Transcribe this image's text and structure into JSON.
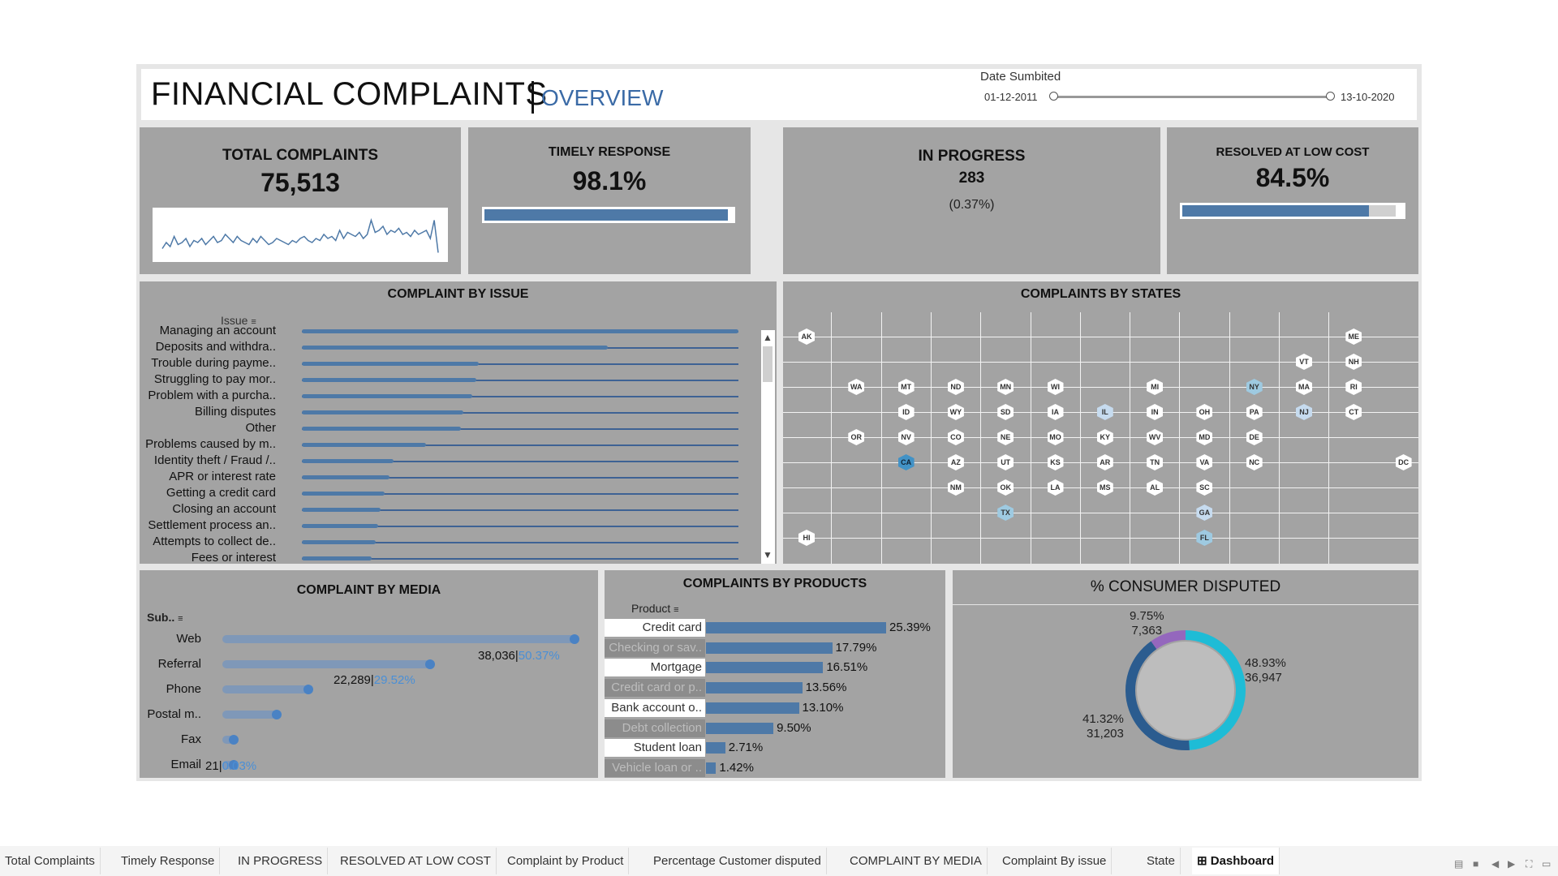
{
  "header": {
    "title": "FINANCIAL COMPLAINTS",
    "subtitle": "OVERVIEW",
    "date_filter": {
      "label": "Date Sumbited",
      "start": "01-12-2011",
      "end": "13-10-2020"
    }
  },
  "kpis": {
    "total": {
      "title": "TOTAL COMPLAINTS",
      "value": "75,513"
    },
    "timely": {
      "title": "TIMELY RESPONSE",
      "value": "98.1%",
      "fraction": 0.981
    },
    "in_progress": {
      "title": "IN PROGRESS",
      "value": "283",
      "pct": "(0.37%)"
    },
    "resolved": {
      "title": "RESOLVED AT LOW COST",
      "value": "84.5%",
      "fraction": 0.845
    }
  },
  "issue_chart": {
    "title": "COMPLAINT BY ISSUE",
    "header": "Issue",
    "items": [
      {
        "label": "Managing an account",
        "value": 1.0
      },
      {
        "label": "Deposits and withdra..",
        "value": 0.7
      },
      {
        "label": "Trouble during payme..",
        "value": 0.405
      },
      {
        "label": "Struggling to pay mor..",
        "value": 0.4
      },
      {
        "label": "Problem with a purcha..",
        "value": 0.39
      },
      {
        "label": "Billing disputes",
        "value": 0.37
      },
      {
        "label": "Other",
        "value": 0.365
      },
      {
        "label": "Problems caused by m..",
        "value": 0.285
      },
      {
        "label": "Identity theft / Fraud /..",
        "value": 0.21
      },
      {
        "label": "APR or interest rate",
        "value": 0.2
      },
      {
        "label": "Getting a credit card",
        "value": 0.19
      },
      {
        "label": "Closing an account",
        "value": 0.18
      },
      {
        "label": "Settlement process an..",
        "value": 0.175
      },
      {
        "label": "Attempts to collect de..",
        "value": 0.17
      },
      {
        "label": "Fees or interest",
        "value": 0.16
      }
    ]
  },
  "states_map": {
    "title": "COMPLAINTS BY STATES",
    "states": [
      {
        "code": "AK",
        "c": 0,
        "r": 0,
        "lvl": 0
      },
      {
        "code": "ME",
        "c": 11,
        "r": 0,
        "lvl": 0
      },
      {
        "code": "VT",
        "c": 10,
        "r": 1,
        "lvl": 0
      },
      {
        "code": "NH",
        "c": 11,
        "r": 1,
        "lvl": 0
      },
      {
        "code": "WA",
        "c": 1,
        "r": 2,
        "lvl": 0
      },
      {
        "code": "MT",
        "c": 2,
        "r": 2,
        "lvl": 0
      },
      {
        "code": "ND",
        "c": 3,
        "r": 2,
        "lvl": 0
      },
      {
        "code": "MN",
        "c": 4,
        "r": 2,
        "lvl": 0
      },
      {
        "code": "WI",
        "c": 5,
        "r": 2,
        "lvl": 0
      },
      {
        "code": "MI",
        "c": 7,
        "r": 2,
        "lvl": 0
      },
      {
        "code": "NY",
        "c": 9,
        "r": 2,
        "lvl": 2
      },
      {
        "code": "MA",
        "c": 10,
        "r": 2,
        "lvl": 0
      },
      {
        "code": "RI",
        "c": 11,
        "r": 2,
        "lvl": 0
      },
      {
        "code": "ID",
        "c": 2,
        "r": 3,
        "lvl": 0
      },
      {
        "code": "WY",
        "c": 3,
        "r": 3,
        "lvl": 0
      },
      {
        "code": "SD",
        "c": 4,
        "r": 3,
        "lvl": 0
      },
      {
        "code": "IA",
        "c": 5,
        "r": 3,
        "lvl": 0
      },
      {
        "code": "IL",
        "c": 6,
        "r": 3,
        "lvl": 1
      },
      {
        "code": "IN",
        "c": 7,
        "r": 3,
        "lvl": 0
      },
      {
        "code": "OH",
        "c": 8,
        "r": 3,
        "lvl": 0
      },
      {
        "code": "PA",
        "c": 9,
        "r": 3,
        "lvl": 0
      },
      {
        "code": "NJ",
        "c": 10,
        "r": 3,
        "lvl": 1
      },
      {
        "code": "CT",
        "c": 11,
        "r": 3,
        "lvl": 0
      },
      {
        "code": "OR",
        "c": 1,
        "r": 4,
        "lvl": 0
      },
      {
        "code": "NV",
        "c": 2,
        "r": 4,
        "lvl": 0
      },
      {
        "code": "CO",
        "c": 3,
        "r": 4,
        "lvl": 0
      },
      {
        "code": "NE",
        "c": 4,
        "r": 4,
        "lvl": 0
      },
      {
        "code": "MO",
        "c": 5,
        "r": 4,
        "lvl": 0
      },
      {
        "code": "KY",
        "c": 6,
        "r": 4,
        "lvl": 0
      },
      {
        "code": "WV",
        "c": 7,
        "r": 4,
        "lvl": 0
      },
      {
        "code": "MD",
        "c": 8,
        "r": 4,
        "lvl": 0
      },
      {
        "code": "DE",
        "c": 9,
        "r": 4,
        "lvl": 0
      },
      {
        "code": "CA",
        "c": 2,
        "r": 5,
        "lvl": 3
      },
      {
        "code": "AZ",
        "c": 3,
        "r": 5,
        "lvl": 0
      },
      {
        "code": "UT",
        "c": 4,
        "r": 5,
        "lvl": 0
      },
      {
        "code": "KS",
        "c": 5,
        "r": 5,
        "lvl": 0
      },
      {
        "code": "AR",
        "c": 6,
        "r": 5,
        "lvl": 0
      },
      {
        "code": "TN",
        "c": 7,
        "r": 5,
        "lvl": 0
      },
      {
        "code": "VA",
        "c": 8,
        "r": 5,
        "lvl": 0
      },
      {
        "code": "NC",
        "c": 9,
        "r": 5,
        "lvl": 0
      },
      {
        "code": "DC",
        "c": 12,
        "r": 5,
        "lvl": 0
      },
      {
        "code": "NM",
        "c": 3,
        "r": 6,
        "lvl": 0
      },
      {
        "code": "OK",
        "c": 4,
        "r": 6,
        "lvl": 0
      },
      {
        "code": "LA",
        "c": 5,
        "r": 6,
        "lvl": 0
      },
      {
        "code": "MS",
        "c": 6,
        "r": 6,
        "lvl": 0
      },
      {
        "code": "AL",
        "c": 7,
        "r": 6,
        "lvl": 0
      },
      {
        "code": "SC",
        "c": 8,
        "r": 6,
        "lvl": 0
      },
      {
        "code": "TX",
        "c": 4,
        "r": 7,
        "lvl": 2
      },
      {
        "code": "GA",
        "c": 8,
        "r": 7,
        "lvl": 1
      },
      {
        "code": "HI",
        "c": 0,
        "r": 8,
        "lvl": 0
      },
      {
        "code": "FL",
        "c": 8,
        "r": 8,
        "lvl": 2
      }
    ]
  },
  "media_chart": {
    "title": "COMPLAINT BY MEDIA",
    "header": "Sub..",
    "items": [
      {
        "label": "Web",
        "fraction": 1.0
      },
      {
        "label": "Referral",
        "fraction": 0.59
      },
      {
        "label": "Phone",
        "fraction": 0.245
      },
      {
        "label": "Postal m..",
        "fraction": 0.155
      },
      {
        "label": "Fax",
        "fraction": 0.03
      },
      {
        "label": "Email",
        "fraction": 0.005
      }
    ],
    "annotations": [
      {
        "count": "38,036",
        "pct": "50.37%"
      },
      {
        "count": "22,289",
        "pct": "29.52%"
      },
      {
        "count": "21",
        "pct": "0.03%"
      }
    ]
  },
  "products_chart": {
    "title": "COMPLAINTS BY PRODUCTS",
    "header": "Product",
    "items": [
      {
        "label": "Credit card",
        "value": 25.39,
        "text": "25.39%",
        "style": "w"
      },
      {
        "label": "Checking or sav..",
        "value": 17.79,
        "text": "17.79%",
        "style": "g"
      },
      {
        "label": "Mortgage",
        "value": 16.51,
        "text": "16.51%",
        "style": "w"
      },
      {
        "label": "Credit card or p..",
        "value": 13.56,
        "text": "13.56%",
        "style": "g"
      },
      {
        "label": "Bank account o..",
        "value": 13.1,
        "text": "13.10%",
        "style": "w"
      },
      {
        "label": "Debt collection",
        "value": 9.5,
        "text": "9.50%",
        "style": "g"
      },
      {
        "label": "Student loan",
        "value": 2.71,
        "text": "2.71%",
        "style": "w"
      },
      {
        "label": "Vehicle loan or ..",
        "value": 1.42,
        "text": "1.42%",
        "style": "g"
      }
    ]
  },
  "disputed_chart": {
    "title": "% CONSUMER DISPUTED",
    "slices": [
      {
        "pct_text": "48.93%",
        "count": "36,947",
        "value": 48.93,
        "color": "#1ebcd6"
      },
      {
        "pct_text": "41.32%",
        "count": "31,203",
        "value": 41.32,
        "color": "#2b5c8f"
      },
      {
        "pct_text": "9.75%",
        "count": "7,363",
        "value": 9.75,
        "color": "#9467bd"
      }
    ]
  },
  "tabs": [
    "Total Complaints",
    "Timely Response",
    "IN PROGRESS",
    "RESOLVED AT LOW COST",
    "Complaint by Product",
    "Percentage Customer disputed",
    "COMPLAINT BY MEDIA",
    "Complaint By issue",
    "State",
    "Dashboard"
  ],
  "active_tab": "Dashboard",
  "colors": {
    "panel": "#a3a3a3",
    "accent": "#4e79a7",
    "title_sub": "#3a6aa6"
  },
  "sparkline": [
    0.15,
    0.3,
    0.2,
    0.45,
    0.25,
    0.3,
    0.4,
    0.2,
    0.35,
    0.3,
    0.4,
    0.25,
    0.35,
    0.45,
    0.3,
    0.35,
    0.5,
    0.4,
    0.3,
    0.45,
    0.35,
    0.3,
    0.25,
    0.4,
    0.3,
    0.45,
    0.35,
    0.25,
    0.3,
    0.4,
    0.35,
    0.3,
    0.25,
    0.35,
    0.3,
    0.4,
    0.45,
    0.35,
    0.3,
    0.4,
    0.35,
    0.5,
    0.4,
    0.45,
    0.35,
    0.6,
    0.4,
    0.55,
    0.5,
    0.45,
    0.55,
    0.4,
    0.5,
    0.85,
    0.55,
    0.6,
    0.7,
    0.5,
    0.6,
    0.55,
    0.65,
    0.5,
    0.55,
    0.45,
    0.6,
    0.5,
    0.55,
    0.6,
    0.4,
    0.85,
    0.05
  ]
}
